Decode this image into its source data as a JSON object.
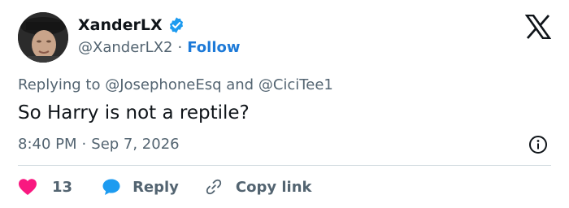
{
  "author": {
    "display_name": "XanderLX",
    "handle": "@XanderLX2",
    "separator": "·",
    "follow_label": "Follow",
    "verified_color": "#1d9bf0"
  },
  "reply_context": {
    "prefix": "Replying to",
    "mention1": "@JosephoneEsq",
    "conjunction": "and",
    "mention2": "@CiciTee1"
  },
  "tweet": {
    "text": "So Harry is not a reptile?",
    "time": "8:40 PM",
    "separator": "·",
    "date": "Sep 7, 2026"
  },
  "actions": {
    "like_count": "13",
    "reply_label": "Reply",
    "copy_link_label": "Copy link"
  },
  "icons": {
    "brand": "x-logo-icon",
    "verified": "verified-badge-icon",
    "info": "info-icon",
    "like": "heart-icon",
    "reply": "reply-bubble-icon",
    "copy": "link-icon"
  },
  "colors": {
    "heart": "#f91880",
    "reply_bubble": "#1d9bf0",
    "follow": "#1d7ad8",
    "secondary_text": "#536471"
  }
}
